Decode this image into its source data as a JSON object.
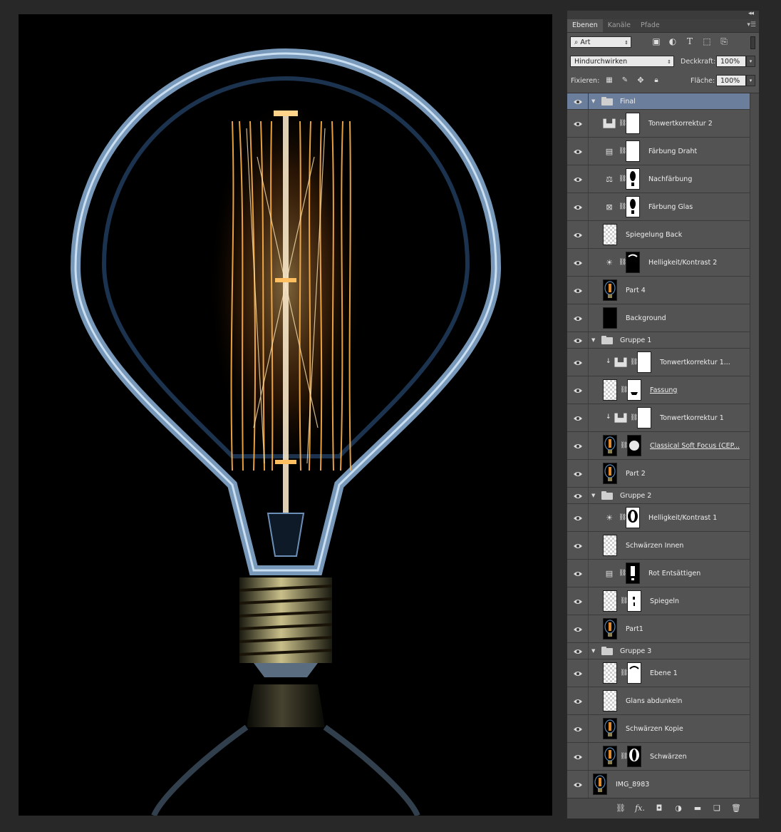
{
  "panel": {
    "collapse_label": "◂◂",
    "tabs": [
      {
        "label": "Ebenen",
        "active": true
      },
      {
        "label": "Kanäle",
        "active": false
      },
      {
        "label": "Pfade",
        "active": false
      }
    ],
    "filter": {
      "value": "Art"
    },
    "blend_mode": {
      "value": "Hindurchwirken"
    },
    "opacity": {
      "label": "Deckkraft:",
      "value": "100%"
    },
    "lock": {
      "label": "Fixieren:"
    },
    "fill": {
      "label": "Fläche:",
      "value": "100%"
    }
  },
  "layers": [
    {
      "name": "Final",
      "type": "group",
      "selected": true,
      "indent": 0
    },
    {
      "name": "Tonwertkorrektur 2",
      "type": "adjustment",
      "icon": "levels-icon",
      "mask": "white",
      "indent": 1
    },
    {
      "name": "Färbung Draht",
      "type": "adjustment",
      "icon": "gradient-map-icon",
      "mask": "white",
      "indent": 1
    },
    {
      "name": "Nachfärbung",
      "type": "adjustment",
      "icon": "color-balance-icon",
      "mask": "bulb-white",
      "indent": 1
    },
    {
      "name": "Färbung Glas",
      "type": "adjustment",
      "icon": "channel-mixer-icon",
      "mask": "bulb-white",
      "indent": 1
    },
    {
      "name": "Spiegelung Back",
      "type": "pixel",
      "thumb": "checker",
      "indent": 1
    },
    {
      "name": "Helligkeit/Kontrast 2",
      "type": "adjustment",
      "icon": "brightness-icon",
      "mask": "black-arc",
      "indent": 1
    },
    {
      "name": "Part 4",
      "type": "pixel",
      "thumb": "bulb",
      "indent": 1
    },
    {
      "name": "Background",
      "type": "pixel",
      "thumb": "black",
      "indent": 1
    },
    {
      "name": "Gruppe 1",
      "type": "group",
      "indent": 0
    },
    {
      "name": "Tonwertkorrektur 1...",
      "type": "adjustment",
      "icon": "levels-icon",
      "mask": "white",
      "clip": true,
      "indent": 1
    },
    {
      "name": "Fassung",
      "type": "pixel-masked",
      "thumb": "checker-socket",
      "mask": "socket-white",
      "underline": true,
      "indent": 1
    },
    {
      "name": "Tonwertkorrektur 1",
      "type": "adjustment",
      "icon": "levels-icon",
      "mask": "white",
      "clip": true,
      "indent": 1
    },
    {
      "name": "Classical Soft Focus (CEP...",
      "type": "smart-filter",
      "thumb": "bulb",
      "mask": "glow",
      "underline": true,
      "indent": 1
    },
    {
      "name": "Part 2",
      "type": "pixel",
      "thumb": "bulb",
      "indent": 1
    },
    {
      "name": "Gruppe 2",
      "type": "group",
      "indent": 0
    },
    {
      "name": "Helligkeit/Kontrast 1",
      "type": "adjustment",
      "icon": "brightness-icon",
      "mask": "bulb-outline",
      "indent": 1
    },
    {
      "name": "Schwärzen Innen",
      "type": "pixel",
      "thumb": "checker-dots",
      "indent": 1
    },
    {
      "name": "Rot Entsättigen",
      "type": "adjustment",
      "icon": "gradient-map-icon",
      "mask": "black-filament",
      "indent": 1
    },
    {
      "name": "Spiegeln",
      "type": "pixel-masked",
      "thumb": "checker-mirror",
      "mask": "white-dots",
      "indent": 1
    },
    {
      "name": "Part1",
      "type": "pixel",
      "thumb": "bulb",
      "indent": 1
    },
    {
      "name": "Gruppe 3",
      "type": "group",
      "indent": 0
    },
    {
      "name": "Ebene 1",
      "type": "pixel-masked",
      "thumb": "checker-arc",
      "mask": "white-arc",
      "indent": 1
    },
    {
      "name": "Glans abdunkeln",
      "type": "pixel",
      "thumb": "checker-dots",
      "indent": 1
    },
    {
      "name": "Schwärzen Kopie",
      "type": "pixel",
      "thumb": "bulb",
      "indent": 1
    },
    {
      "name": "Schwärzen",
      "type": "pixel-masked",
      "thumb": "bulb",
      "mask": "black-bulb",
      "indent": 1
    },
    {
      "name": "IMG_8983",
      "type": "pixel",
      "thumb": "bulb-smart",
      "indent": 0
    }
  ],
  "footer": {
    "buttons": [
      "link-icon",
      "fx-icon",
      "mask-icon",
      "adjustment-icon",
      "folder-icon",
      "new-layer-icon",
      "trash-icon"
    ],
    "fx_label": "fx."
  }
}
